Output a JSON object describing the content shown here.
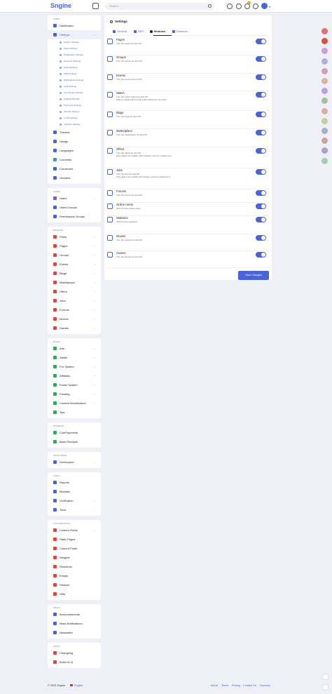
{
  "app": {
    "logo": "Sngine"
  },
  "search": {
    "placeholder": "Search"
  },
  "topbar": {
    "notifications_badge": "1"
  },
  "sidebar": {
    "sections": [
      {
        "title": "ADMIN",
        "items": [
          {
            "label": "Dashboard",
            "color": "#4a63d8"
          },
          {
            "label": "Settings",
            "color": "#4a63d8",
            "active": true,
            "chev": "⌄"
          },
          {
            "label": "Themes",
            "color": "#4a63d8"
          },
          {
            "label": "Design",
            "color": "#4a63d8"
          },
          {
            "label": "Languages",
            "color": "#4a63d8"
          },
          {
            "label": "Countries",
            "color": "#2aa0b0"
          },
          {
            "label": "Currencies",
            "color": "#4a63d8"
          },
          {
            "label": "Genders",
            "color": "#4a63d8"
          }
        ],
        "subitems": [
          "System Settings",
          "Posts Settings",
          "Registration Settings",
          "Accounts Settings",
          "Email Settings",
          "SMS Settings",
          "Notifications Settings",
          "Chat Settings",
          "Live Stream Settings",
          "Uploads Settings",
          "Payments Settings",
          "Security Settings",
          "Limits Settings",
          "Analytics Settings"
        ]
      },
      {
        "title": "USERS",
        "items": [
          {
            "label": "Users",
            "color": "#7b5cd6",
            "chev": "›"
          },
          {
            "label": "Users Groups",
            "color": "#4a63d8"
          },
          {
            "label": "Permissions Groups",
            "color": "#4a63d8"
          }
        ]
      },
      {
        "title": "MODULES",
        "items": [
          {
            "label": "Posts",
            "color": "#e0453a",
            "chev": "›"
          },
          {
            "label": "Pages",
            "color": "#e0453a",
            "chev": "›"
          },
          {
            "label": "Groups",
            "color": "#e0453a",
            "chev": "›"
          },
          {
            "label": "Events",
            "color": "#e0453a",
            "chev": "›"
          },
          {
            "label": "Blogs",
            "color": "#e0453a",
            "chev": "›"
          },
          {
            "label": "Marketplace",
            "color": "#e0453a",
            "chev": "›"
          },
          {
            "label": "Offers",
            "color": "#e0453a",
            "chev": "›"
          },
          {
            "label": "Jobs",
            "color": "#e0453a",
            "chev": "›"
          },
          {
            "label": "Forums",
            "color": "#e0453a",
            "chev": "›"
          },
          {
            "label": "Movies",
            "color": "#e0453a",
            "chev": "›"
          },
          {
            "label": "Games",
            "color": "#e0453a",
            "chev": "›"
          }
        ]
      },
      {
        "title": "MONEY",
        "items": [
          {
            "label": "Ads",
            "color": "#2eaa5a",
            "chev": "›"
          },
          {
            "label": "Wallet",
            "color": "#2eaa5a",
            "chev": "›"
          },
          {
            "label": "Pro System",
            "color": "#2eaa5a",
            "chev": "›"
          },
          {
            "label": "Affiliates",
            "color": "#2eaa5a",
            "chev": "›"
          },
          {
            "label": "Points System",
            "color": "#2eaa5a",
            "chev": "›"
          },
          {
            "label": "Funding",
            "color": "#2eaa5a",
            "chev": "›"
          },
          {
            "label": "Content Monetization",
            "color": "#2eaa5a",
            "chev": "›"
          },
          {
            "label": "Tips",
            "color": "#2eaa5a"
          }
        ]
      },
      {
        "title": "PAYMENTS",
        "items": [
          {
            "label": "CoinPayments",
            "color": "#2eaa5a"
          },
          {
            "label": "Bank Receipts",
            "color": "#2eaa5a"
          }
        ]
      },
      {
        "title": "DEVELOPERS",
        "items": [
          {
            "label": "Developers",
            "color": "#4a63d8",
            "chev": "›"
          }
        ]
      },
      {
        "title": "TOOLS",
        "items": [
          {
            "label": "Reports",
            "color": "#4a63d8"
          },
          {
            "label": "Blacklist",
            "color": "#4a63d8"
          },
          {
            "label": "Verification",
            "color": "#4a63d8",
            "chev": "›"
          },
          {
            "label": "Tools",
            "color": "#4a63d8",
            "chev": "›"
          }
        ]
      },
      {
        "title": "CUSTOMIZATION",
        "items": [
          {
            "label": "Custom Fields",
            "color": "#e0453a",
            "chev": "›"
          },
          {
            "label": "Static Pages",
            "color": "#e0453a"
          },
          {
            "label": "Colored Posts",
            "color": "#e0453a"
          },
          {
            "label": "Widgets",
            "color": "#e0453a"
          },
          {
            "label": "Reactions",
            "color": "#e0453a"
          },
          {
            "label": "Emojis",
            "color": "#e0453a"
          },
          {
            "label": "Stickers",
            "color": "#e0453a"
          },
          {
            "label": "Gifts",
            "color": "#e0453a"
          }
        ]
      },
      {
        "title": "REACH",
        "items": [
          {
            "label": "Announcements",
            "color": "#4a63d8"
          },
          {
            "label": "Mass Notifications",
            "color": "#4a63d8"
          },
          {
            "label": "Newsletter",
            "color": "#4a63d8"
          }
        ]
      },
      {
        "title": "ABOUT",
        "items": [
          {
            "label": "Changelog",
            "color": "#e0453a"
          },
          {
            "label": "Build v3.11",
            "color": "#e0453a"
          }
        ]
      }
    ]
  },
  "main": {
    "title": "Settings",
    "tabs": [
      "General",
      "SEO",
      "Modules",
      "Features"
    ],
    "active_tab": "Modules",
    "modules": [
      {
        "title": "Pages",
        "desc": "Turn the pages On and Off"
      },
      {
        "title": "Groups",
        "desc": "Turn the groups On and Off"
      },
      {
        "title": "Events",
        "desc": "Turn the events On and Off"
      },
      {
        "title": "Watch",
        "desc": "Turn the watch videos On and Off\nWatch module will show all public videos as one place"
      },
      {
        "title": "Blogs",
        "desc": "Turn the blogs On and Off"
      },
      {
        "title": "Marketplace",
        "desc": "Turn the marketplace On and Off"
      },
      {
        "title": "Offers",
        "desc": "Turn the offers On and Off\nOnly pages can publish offers (Pages must be enabled too)"
      },
      {
        "title": "Jobs",
        "desc": "Turn the jobs On and Off\nOnly pages can publish jobs (Pages must be enabled too)"
      },
      {
        "title": "Forums",
        "desc": "Turn the forums On and Off"
      },
      {
        "title": "Online Users",
        "desc": "Show forums online users"
      },
      {
        "title": "Statistics",
        "desc": "Show forums statistics"
      },
      {
        "title": "Movies",
        "desc": "Turn the movies On and Off"
      },
      {
        "title": "Games",
        "desc": "Turn the games On and Off"
      }
    ],
    "save_label": "Save Changes"
  },
  "footer": {
    "copyright": "© 2023 Sngine",
    "language": "English",
    "links": [
      "About",
      "Terms",
      "Privacy",
      "Contact Us",
      "Directory"
    ]
  },
  "right_rail_colors": [
    "#e07070",
    "#d85040",
    "#c9a0d0",
    "#b0b0d0",
    "#d0a0c0",
    "#e0b0a0",
    "#c0a0e0",
    "#a0c0a0",
    "#d8b0a0",
    "#c0d0a0",
    "#a0b0d0",
    "#d0a0a0",
    "#b0a0d0",
    "#a0d0b0"
  ]
}
